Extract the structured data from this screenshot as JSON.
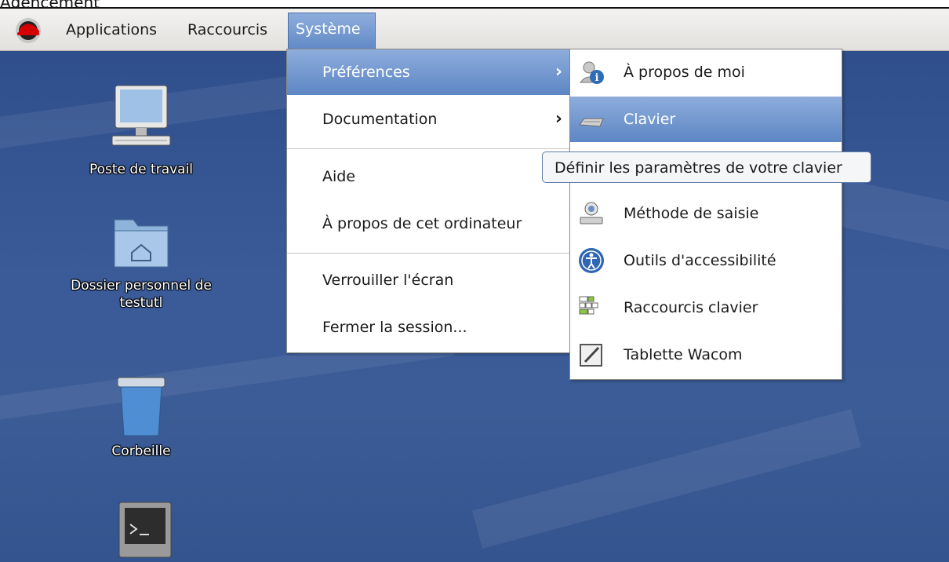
{
  "header": {
    "caption": "Agencement"
  },
  "panel": {
    "applications": "Applications",
    "raccourcis": "Raccourcis",
    "systeme": "Système"
  },
  "desktop": {
    "icons": [
      {
        "label": "Poste de travail"
      },
      {
        "label1": "Dossier personnel de",
        "label2": "testutl"
      },
      {
        "label": "Corbeille"
      }
    ]
  },
  "system_menu": {
    "preferences": "Préférences",
    "documentation": "Documentation",
    "aide": "Aide",
    "apropos_ordi": "À propos de cet ordinateur",
    "verrouiller": "Verrouiller l'écran",
    "fermer": "Fermer la session...",
    "arrow": "›"
  },
  "preferences_menu": {
    "items": [
      {
        "label": "À propos de moi",
        "icon": "about-me-icon"
      },
      {
        "label": "Clavier",
        "icon": "keyboard-icon"
      },
      {
        "label": "Méthode de saisie",
        "icon": "input-method-icon"
      },
      {
        "label": "Outils d'accessibilité",
        "icon": "accessibility-icon"
      },
      {
        "label": "Raccourcis clavier",
        "icon": "keyboard-shortcuts-icon"
      },
      {
        "label": "Tablette Wacom",
        "icon": "wacom-tablet-icon"
      }
    ]
  },
  "tooltip": {
    "text": "Définir les paramètres de votre clavier"
  },
  "colors": {
    "highlight": "#6b90cc",
    "desktop": "#3a5a98"
  }
}
